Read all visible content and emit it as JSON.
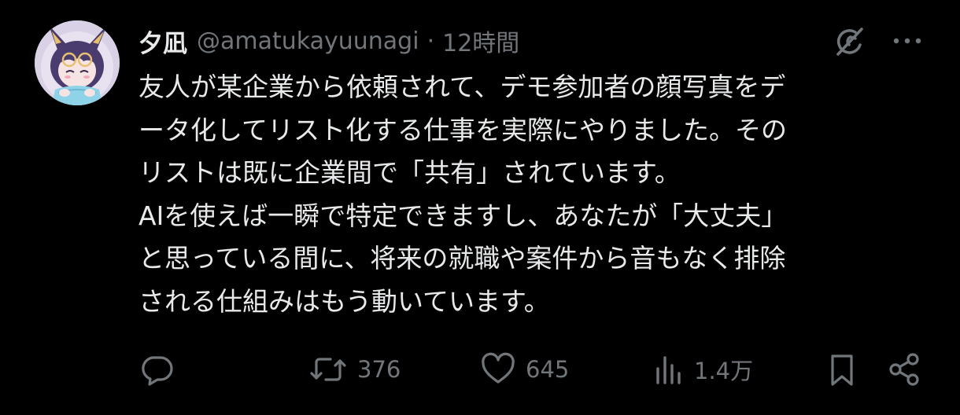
{
  "user": {
    "name": "夕凪",
    "handle": "@amatukayuunagi",
    "separator": "·",
    "time": "12時間"
  },
  "header_icons": {
    "grok": "grok-icon",
    "more": "more-icon"
  },
  "tweet": {
    "lines": [
      "友人が某企業から依頼されて、デモ参加者の顔写真をデ",
      "ータ化してリスト化する仕事を実際にやりました。その",
      "リストは既に企業間で「共有」されています。",
      "AIを使えば一瞬で特定できますし、あなたが「大丈夫」",
      "と思っている間に、将来の就職や案件から音もなく排除",
      "される仕組みはもう動いています。"
    ]
  },
  "actions": {
    "reply": {
      "icon": "reply-icon",
      "count": ""
    },
    "retweet": {
      "icon": "retweet-icon",
      "count": "376"
    },
    "like": {
      "icon": "heart-icon",
      "count": "645"
    },
    "views": {
      "icon": "views-icon",
      "count": "1.4万"
    },
    "bookmark": {
      "icon": "bookmark-icon"
    },
    "share": {
      "icon": "share-icon"
    }
  },
  "colors": {
    "background": "#000000",
    "text_primary": "#e7e9ea",
    "text_secondary": "#71767b"
  }
}
